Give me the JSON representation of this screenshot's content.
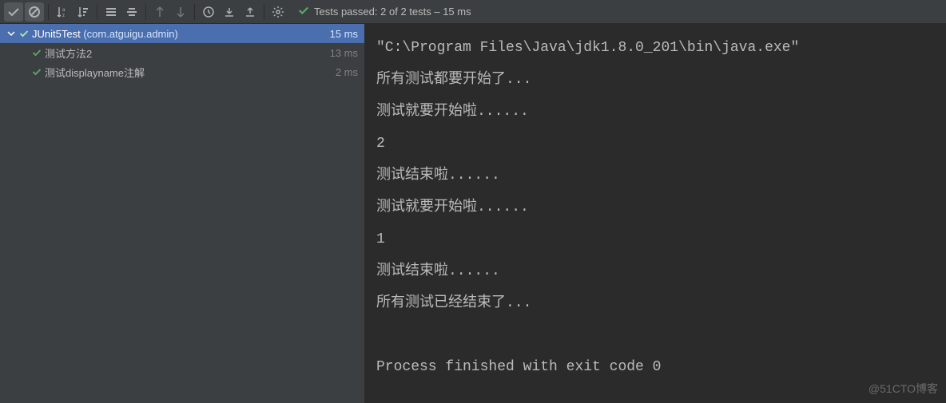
{
  "toolbar": {
    "status_prefix": "Tests passed:",
    "passed_count": "2",
    "status_mid": "of 2 tests",
    "status_time": "– 15 ms"
  },
  "tree": {
    "root": {
      "name": "JUnit5Test",
      "pkg": "(com.atguigu.admin)",
      "time": "15 ms"
    },
    "children": [
      {
        "name": "测试方法2",
        "time": "13 ms"
      },
      {
        "name": "测试displayname注解",
        "time": "2 ms"
      }
    ]
  },
  "console": {
    "lines": [
      "\"C:\\Program Files\\Java\\jdk1.8.0_201\\bin\\java.exe\"",
      "所有测试都要开始了...",
      "测试就要开始啦......",
      "2",
      "测试结束啦......",
      "测试就要开始啦......",
      "1",
      "测试结束啦......",
      "所有测试已经结束了...",
      "",
      "Process finished with exit code 0"
    ]
  },
  "watermark": "@51CTO博客"
}
